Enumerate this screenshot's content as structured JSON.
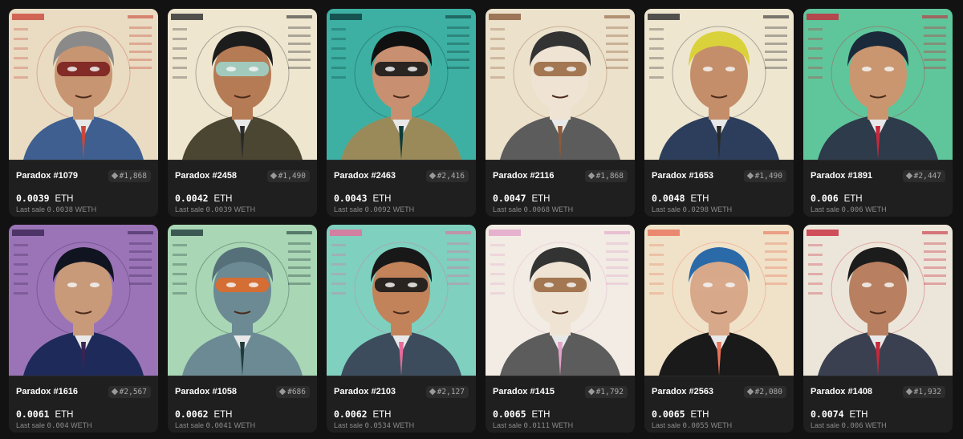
{
  "cards": [
    {
      "name": "Paradox #1079",
      "rank": "#1,868",
      "price": "0.0039",
      "unit": "ETH",
      "last_sale_label": "Last sale",
      "last_sale_value": "0.0038",
      "last_sale_unit": "WETH",
      "art": {
        "bg": "#e9dcc2",
        "accent": "#c9473a",
        "skin": "#c79572",
        "hair": "#8a8a8a",
        "mask": "#7a1f1f",
        "suit": "#3e5f8f",
        "icon": "masked-man-portrait-icon"
      }
    },
    {
      "name": "Paradox #2458",
      "rank": "#1,490",
      "price": "0.0042",
      "unit": "ETH",
      "last_sale_label": "Last sale",
      "last_sale_value": "0.0039",
      "last_sale_unit": "WETH",
      "art": {
        "bg": "#efe6d0",
        "accent": "#2a2a2a",
        "skin": "#b57b55",
        "hair": "#1c1c1c",
        "mask": "#9fd3c8",
        "suit": "#4a4632",
        "icon": "half-mask-man-portrait-icon"
      }
    },
    {
      "name": "Paradox #2463",
      "rank": "#2,416",
      "price": "0.0043",
      "unit": "ETH",
      "last_sale_label": "Last sale",
      "last_sale_value": "0.0092",
      "last_sale_unit": "WETH",
      "art": {
        "bg": "#3db0a3",
        "accent": "#0d3b3a",
        "skin": "#c89070",
        "hair": "#101010",
        "mask": "#1a1a1a",
        "suit": "#9a8a5a",
        "icon": "helmet-man-portrait-icon"
      }
    },
    {
      "name": "Paradox #2116",
      "rank": "#1,868",
      "price": "0.0047",
      "unit": "ETH",
      "last_sale_label": "Last sale",
      "last_sale_value": "0.0068",
      "last_sale_unit": "WETH",
      "art": {
        "bg": "#ece1cb",
        "accent": "#8a5a3a",
        "skin": "#efe4d4",
        "hair": "#333333",
        "mask": "#9a6a44",
        "suit": "#5c5c5c",
        "icon": "squirrel-mask-portrait-icon"
      }
    },
    {
      "name": "Paradox #1653",
      "rank": "#1,490",
      "price": "0.0048",
      "unit": "ETH",
      "last_sale_label": "Last sale",
      "last_sale_value": "0.0298",
      "last_sale_unit": "WETH",
      "art": {
        "bg": "#efe6d0",
        "accent": "#2a2a2a",
        "skin": "#c48e6a",
        "hair": "#d9d23a",
        "mask": "#c48e6a",
        "suit": "#2c3e5c",
        "icon": "blond-man-portrait-icon"
      }
    },
    {
      "name": "Paradox #1891",
      "rank": "#2,447",
      "price": "0.006",
      "unit": "ETH",
      "last_sale_label": "Last sale",
      "last_sale_value": "0.006",
      "last_sale_unit": "WETH",
      "art": {
        "bg": "#5fc69b",
        "accent": "#c8283a",
        "skin": "#c99670",
        "hair": "#1a2a3a",
        "mask": "#c99670",
        "suit": "#2d3b4a",
        "icon": "billiard-ball-man-portrait-icon"
      }
    },
    {
      "name": "Paradox #1616",
      "rank": "#2,567",
      "price": "0.0061",
      "unit": "ETH",
      "last_sale_label": "Last sale",
      "last_sale_value": "0.004",
      "last_sale_unit": "WETH",
      "art": {
        "bg": "#9b74b8",
        "accent": "#3a2452",
        "skin": "#c89a7a",
        "hair": "#101420",
        "mask": "#c89a7a",
        "suit": "#1e2a5a",
        "icon": "punk-girl-portrait-icon"
      }
    },
    {
      "name": "Paradox #1058",
      "rank": "#686",
      "price": "0.0062",
      "unit": "ETH",
      "last_sale_label": "Last sale",
      "last_sale_value": "0.0041",
      "last_sale_unit": "WETH",
      "art": {
        "bg": "#a9d6b4",
        "accent": "#1f3a3a",
        "skin": "#6c8a94",
        "hair": "#56707a",
        "mask": "#e06a2a",
        "suit": "#6c8a94",
        "icon": "stone-block-robot-portrait-icon"
      }
    },
    {
      "name": "Paradox #2103",
      "rank": "#2,127",
      "price": "0.0062",
      "unit": "ETH",
      "last_sale_label": "Last sale",
      "last_sale_value": "0.0534",
      "last_sale_unit": "WETH",
      "art": {
        "bg": "#7fd0bf",
        "accent": "#e96a9a",
        "skin": "#c2835a",
        "hair": "#181818",
        "mask": "#1a1a1a",
        "suit": "#3c4c5c",
        "icon": "sunglasses-man-portrait-icon"
      }
    },
    {
      "name": "Paradox #1415",
      "rank": "#1,792",
      "price": "0.0065",
      "unit": "ETH",
      "last_sale_label": "Last sale",
      "last_sale_value": "0.0111",
      "last_sale_unit": "WETH",
      "art": {
        "bg": "#f2ece4",
        "accent": "#e2a2c8",
        "skin": "#efe4d4",
        "hair": "#333333",
        "mask": "#9a6a44",
        "suit": "#5c5c5c",
        "icon": "squirrel-mask-portrait-icon"
      }
    },
    {
      "name": "Paradox #2563",
      "rank": "#2,080",
      "price": "0.0065",
      "unit": "ETH",
      "last_sale_label": "Last sale",
      "last_sale_value": "0.0055",
      "last_sale_unit": "WETH",
      "art": {
        "bg": "#f0e2c8",
        "accent": "#e8735a",
        "skin": "#d8a88a",
        "hair": "#2a6aa8",
        "mask": "#d8a88a",
        "suit": "#1a1a1a",
        "icon": "blue-hair-woman-portrait-icon"
      }
    },
    {
      "name": "Paradox #1408",
      "rank": "#1,932",
      "price": "0.0074",
      "unit": "ETH",
      "last_sale_label": "Last sale",
      "last_sale_value": "0.006",
      "last_sale_unit": "WETH",
      "art": {
        "bg": "#ece6da",
        "accent": "#c8283a",
        "skin": "#b88060",
        "hair": "#1c1c1c",
        "mask": "#b88060",
        "suit": "#3a4050",
        "icon": "heavyset-man-portrait-icon"
      }
    }
  ]
}
